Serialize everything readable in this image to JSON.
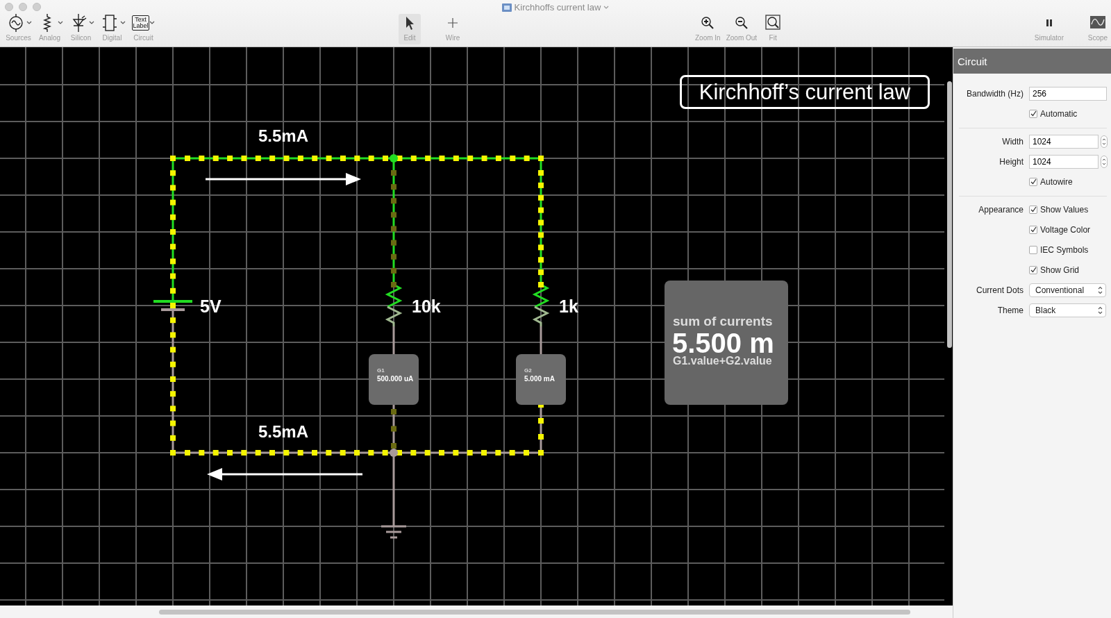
{
  "window": {
    "title": "Kirchhoffs current law"
  },
  "toolbar": {
    "parts": [
      {
        "label": "Sources",
        "kind": "source",
        "menu": true
      },
      {
        "label": "Analog",
        "kind": "resistor",
        "menu": true
      },
      {
        "label": "Silicon",
        "kind": "diode",
        "menu": true
      },
      {
        "label": "Digital",
        "kind": "chip",
        "menu": true
      },
      {
        "label": "Circuit",
        "kind": "textlabel",
        "menu": true,
        "icon_text": [
          "Text",
          "Label"
        ]
      }
    ],
    "modes": [
      {
        "label": "Edit",
        "kind": "pointer",
        "selected": true
      },
      {
        "label": "Wire",
        "kind": "plus",
        "selected": false
      }
    ],
    "zoom": [
      {
        "label": "Zoom In",
        "kind": "zoomin"
      },
      {
        "label": "Zoom Out",
        "kind": "zoomout"
      },
      {
        "label": "Fit",
        "kind": "fit"
      }
    ],
    "right": [
      {
        "label": "Simulator",
        "kind": "pause"
      },
      {
        "label": "Scope",
        "kind": "scope"
      }
    ]
  },
  "circuit": {
    "title_label": "Kirchhoff’s current law",
    "current_labels": [
      "5.5mA",
      "5.5mA"
    ],
    "source": {
      "label": "5V"
    },
    "resistors": [
      {
        "label": "10k"
      },
      {
        "label": "1k"
      }
    ],
    "meters": [
      {
        "name": "G1",
        "reading": "500.000 uA"
      },
      {
        "name": "G2",
        "reading": "5.000 mA"
      }
    ],
    "sum_box": {
      "title": "sum of currents",
      "value": "5.500 m",
      "formula": "G1.value+G2.value"
    }
  },
  "inspector": {
    "title": "Circuit",
    "sections": [
      {
        "rows": [
          {
            "kind": "text",
            "label": "Bandwidth (Hz)",
            "value": "256"
          },
          {
            "kind": "checkbox",
            "text": "Automatic",
            "checked": true
          }
        ]
      },
      {
        "rows": [
          {
            "kind": "stepper",
            "label": "Width",
            "value": "1024"
          },
          {
            "kind": "stepper",
            "label": "Height",
            "value": "1024"
          },
          {
            "kind": "checkbox",
            "text": "Autowire",
            "checked": true
          }
        ]
      },
      {
        "rows": [
          {
            "kind": "checkbox",
            "label": "Appearance",
            "text": "Show Values",
            "checked": true
          },
          {
            "kind": "checkbox",
            "text": "Voltage Color",
            "checked": true
          },
          {
            "kind": "checkbox",
            "text": "IEC Symbols",
            "checked": false
          },
          {
            "kind": "checkbox",
            "text": "Show Grid",
            "checked": true
          },
          {
            "kind": "select",
            "label": "Current Dots",
            "value": "Conventional"
          },
          {
            "kind": "select",
            "label": "Theme",
            "value": "Black"
          }
        ]
      }
    ]
  }
}
